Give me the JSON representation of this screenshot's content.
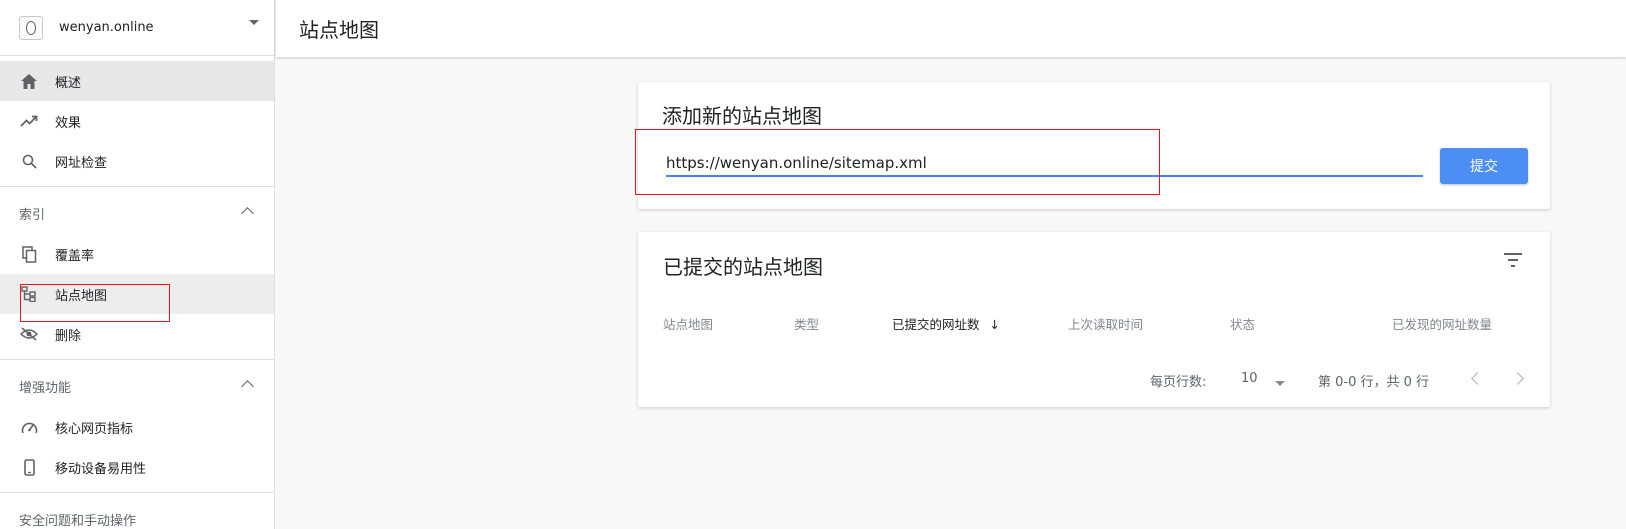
{
  "property": {
    "name": "wenyan.online"
  },
  "sidebar": {
    "items_top": [
      {
        "label": "概述",
        "icon": "home-icon"
      },
      {
        "label": "效果",
        "icon": "trending-up-icon"
      },
      {
        "label": "网址检查",
        "icon": "search-icon"
      }
    ],
    "section_index": {
      "title": "索引",
      "items": [
        {
          "label": "覆盖率",
          "icon": "copy-icon"
        },
        {
          "label": "站点地图",
          "icon": "sitemap-icon"
        },
        {
          "label": "删除",
          "icon": "visibility-off-icon"
        }
      ]
    },
    "section_enhance": {
      "title": "增强功能",
      "items": [
        {
          "label": "核心网页指标",
          "icon": "speed-icon"
        },
        {
          "label": "移动设备易用性",
          "icon": "smartphone-icon"
        }
      ]
    },
    "section_partial": {
      "title": "安全问题和手动操作"
    }
  },
  "header": {
    "title": "站点地图"
  },
  "add_card": {
    "title": "添加新的站点地图",
    "url_value": "https://wenyan.online/sitemap.xml",
    "submit_label": "提交"
  },
  "submitted_card": {
    "title": "已提交的站点地图",
    "columns": [
      "站点地图",
      "类型",
      "已提交的网址数",
      "上次读取时间",
      "状态",
      "已发现的网址数量"
    ],
    "sort_arrow": "↓",
    "rows_per_page_label": "每页行数:",
    "rows_per_page_value": "10",
    "range_text": "第 0-0 行，共 0 行"
  },
  "colors": {
    "accent": "#4285f4",
    "highlight_box": "#e8151b"
  }
}
